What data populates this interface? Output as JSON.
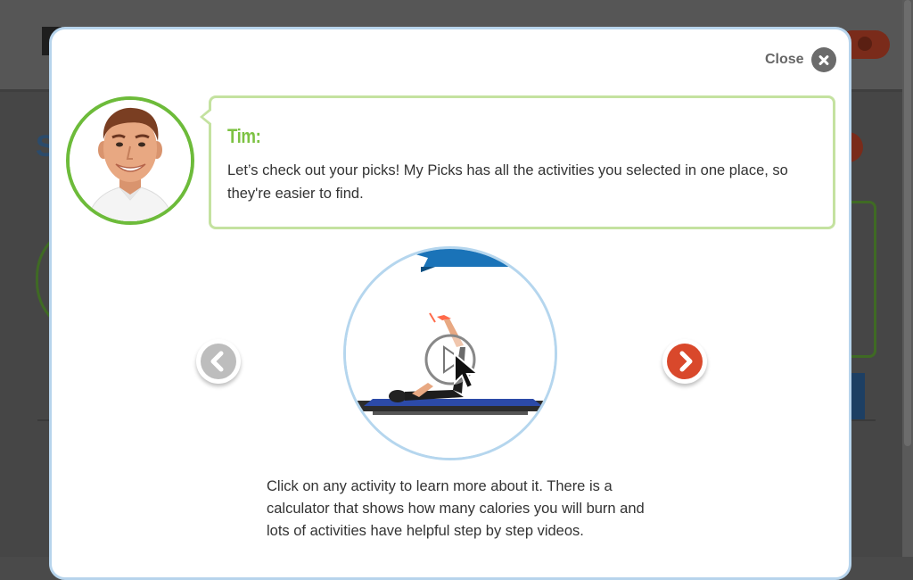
{
  "modal": {
    "close_label": "Close",
    "speaker": "Tim:",
    "message": "Let’s check out your picks! My Picks has all the activities you selected in one place, so they're easier to find.",
    "description": "Click on any activity to learn more about it. There is a calculator that shows how many calories you will burn and lots of activities have helpful step by step videos.",
    "prev_icon": "chevron-left-icon",
    "next_icon": "chevron-right-icon",
    "colors": {
      "accent_green": "#6dbb3a",
      "bubble_border": "#c4e2a0",
      "next_button": "#d9482b",
      "prev_button": "#bdbdbd",
      "modal_border": "#b7d4ec"
    }
  }
}
